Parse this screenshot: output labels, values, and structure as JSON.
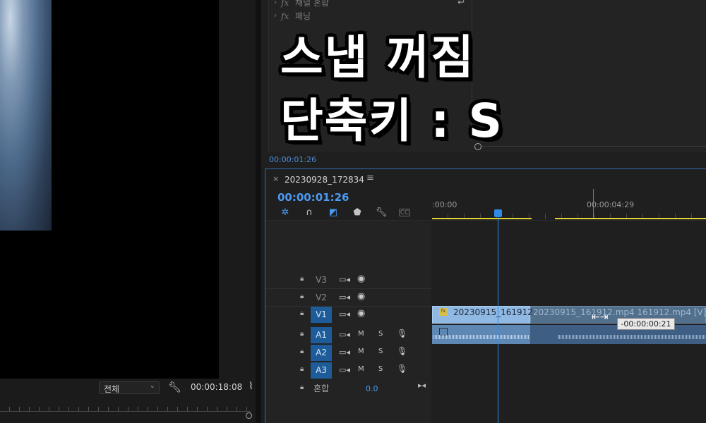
{
  "overlay": {
    "line1": "스냅 꺼짐",
    "line2": "단축키 : S"
  },
  "program_monitor": {
    "fit_value": "전체",
    "duration_timecode": "00:00:18:08"
  },
  "effect_controls": {
    "rows": [
      {
        "label": "채널 혼합"
      },
      {
        "label": "패닝"
      }
    ],
    "timecode": "00:00:01:26"
  },
  "timeline": {
    "sequence_name": "20230928_172834",
    "playhead_timecode": "00:00:01:26",
    "ruler_labels": [
      ":00:00",
      "00:00:04:29"
    ],
    "tools": {
      "captions_label": "CC"
    },
    "video_tracks": [
      {
        "name": "V3",
        "targeted": false
      },
      {
        "name": "V2",
        "targeted": false
      },
      {
        "name": "V1",
        "targeted": true
      }
    ],
    "audio_tracks": [
      {
        "name": "A1",
        "mute": "M",
        "solo": "S"
      },
      {
        "name": "A2",
        "mute": "M",
        "solo": "S"
      },
      {
        "name": "A3",
        "mute": "M",
        "solo": "S"
      }
    ],
    "mix": {
      "name": "혼합",
      "value": "0.0"
    },
    "clips": {
      "v1_label": "20230915_161912.",
      "v1_ghost_label": "20230915_161912.mp4 161912.mp4 [V]",
      "trim_tooltip": "-00:00:00:21"
    }
  },
  "colors": {
    "accent_blue": "#2f8ae6",
    "work_area": "#e5d32e",
    "video_clip": "#8fb8e3",
    "audio_clip": "#5e87b3"
  }
}
